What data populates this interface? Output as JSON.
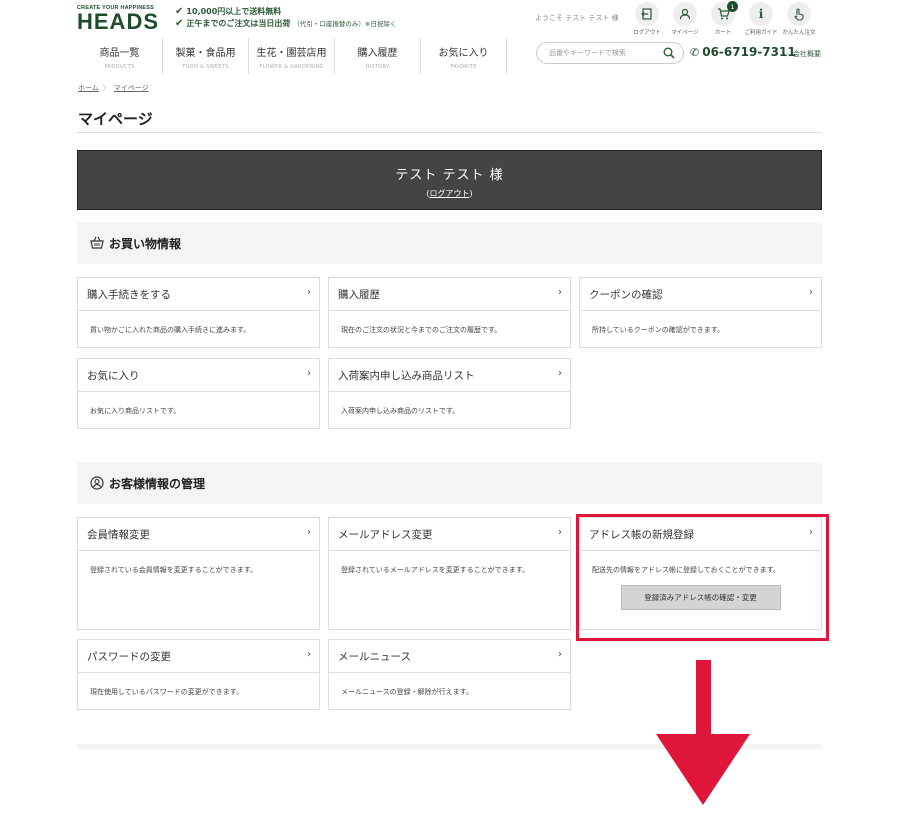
{
  "header": {
    "logo_tag": "CREATE YOUR HAPPINESS",
    "logo_name": "HEADS",
    "promo_1": "10,000円以上で送料無料",
    "promo_2": "正午までのご注文は当日出荷",
    "promo_2_note": "（代引・口座振替のみ）※日祝除く",
    "welcome": "ようこそ テスト テスト 様",
    "icons": [
      {
        "label": "ログアウト",
        "icon": "logout-icon"
      },
      {
        "label": "マイページ",
        "icon": "user-icon"
      },
      {
        "label": "カート",
        "icon": "cart-icon",
        "badge": "1"
      },
      {
        "label": "ご利用ガイド",
        "icon": "info-icon"
      },
      {
        "label": "かんたん注文",
        "icon": "hand-icon"
      }
    ],
    "nav": [
      {
        "jp": "商品一覧",
        "en": "PRODUCTS"
      },
      {
        "jp": "製菓・食品用",
        "en": "FOOD & SWEETS"
      },
      {
        "jp": "生花・園芸店用",
        "en": "FLOWER & GARDENING"
      },
      {
        "jp": "購入履歴",
        "en": "HISTORY"
      },
      {
        "jp": "お気に入り",
        "en": "FAVORITE"
      }
    ],
    "search_placeholder": "品番やキーワードで検索",
    "phone": "06-6719-7311",
    "company": "会社概要"
  },
  "breadcrumb": {
    "home": "ホーム",
    "current": "マイページ"
  },
  "page_title": "マイページ",
  "welcome_box": {
    "name": "テスト テスト 様",
    "logout": "ログアウト"
  },
  "shopping": {
    "title": "お買い物情報",
    "cards": [
      {
        "title": "購入手続きをする",
        "desc": "買い物かごに入れた商品の購入手続きに進みます。"
      },
      {
        "title": "購入履歴",
        "desc": "現在のご注文の状況と今までのご注文の履歴です。"
      },
      {
        "title": "クーポンの確認",
        "desc": "所持しているクーポンの確認ができます。"
      },
      {
        "title": "お気に入り",
        "desc": "お気に入り商品リストです。"
      },
      {
        "title": "入荷案内申し込み商品リスト",
        "desc": "入荷案内申し込み商品のリストです。"
      }
    ]
  },
  "customer": {
    "title": "お客様情報の管理",
    "cards": [
      {
        "title": "会員情報変更",
        "desc": "登録されている会員情報を変更することができます。"
      },
      {
        "title": "メールアドレス変更",
        "desc": "登録されているメールアドレスを変更することができます。"
      },
      {
        "title": "アドレス帳の新規登録",
        "desc": "配送先の情報をアドレス帳に登録しておくことができます。",
        "button": "登録済みアドレス帳の確認・変更"
      },
      {
        "title": "パスワードの変更",
        "desc": "現在使用しているパスワードの変更ができます。"
      },
      {
        "title": "メールニュース",
        "desc": "メールニュースの登録・解除が行えます。"
      }
    ]
  },
  "colors": {
    "brand": "#1f4d2c",
    "highlight": "#e0153a",
    "banner": "#444444"
  }
}
